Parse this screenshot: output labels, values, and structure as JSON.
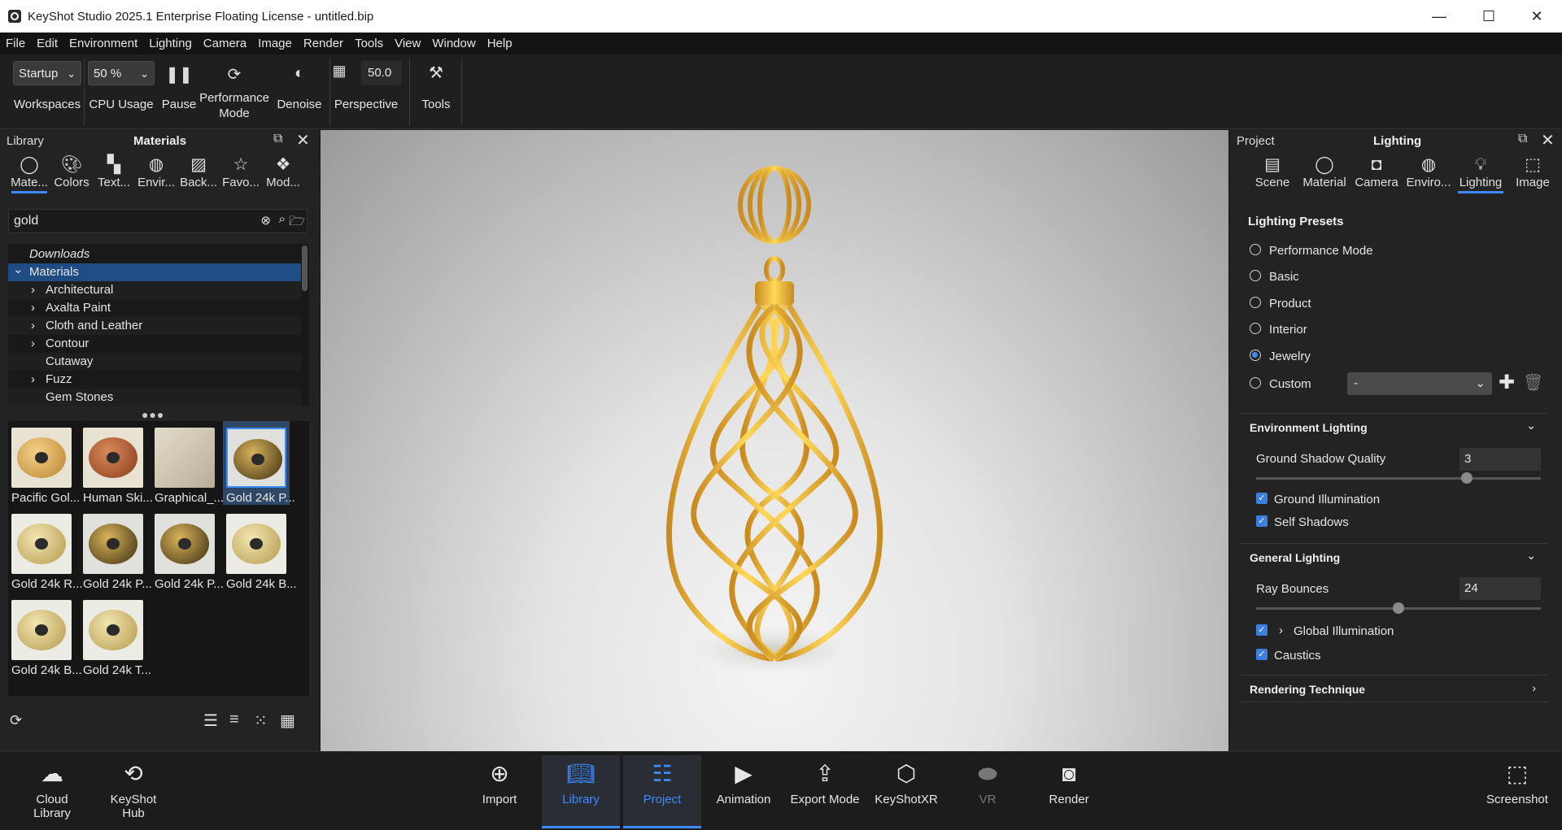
{
  "window": {
    "title": "KeyShot Studio 2025.1 Enterprise Floating License  - untitled.bip"
  },
  "menu": [
    "File",
    "Edit",
    "Environment",
    "Lighting",
    "Camera",
    "Image",
    "Render",
    "Tools",
    "View",
    "Window",
    "Help"
  ],
  "toolbar": {
    "workspace_value": "Startup",
    "workspaces_label": "Workspaces",
    "cpu_value": "50 %",
    "cpu_label": "CPU Usage",
    "pause_label": "Pause",
    "perf_label_1": "Performance",
    "perf_label_2": "Mode",
    "denoise_label": "Denoise",
    "fov_value": "50.0",
    "perspective_label": "Perspective",
    "tools_label": "Tools"
  },
  "library": {
    "left_title": "Library",
    "center_title": "Materials",
    "tabs": [
      {
        "label": "Mate...",
        "icon": "material-icon"
      },
      {
        "label": "Colors",
        "icon": "palette-icon"
      },
      {
        "label": "Text...",
        "icon": "texture-icon"
      },
      {
        "label": "Envir...",
        "icon": "globe-icon"
      },
      {
        "label": "Back...",
        "icon": "image-icon"
      },
      {
        "label": "Favo...",
        "icon": "star-icon"
      },
      {
        "label": "Mod...",
        "icon": "models-icon"
      }
    ],
    "search_value": "gold",
    "tree": [
      {
        "label": "Downloads",
        "indent": 0,
        "arrow": "",
        "italic": true,
        "selected": false
      },
      {
        "label": "Materials",
        "indent": 0,
        "arrow": "⌄",
        "italic": false,
        "selected": true
      },
      {
        "label": "Architectural",
        "indent": 1,
        "arrow": "›",
        "italic": false,
        "selected": false
      },
      {
        "label": "Axalta Paint",
        "indent": 1,
        "arrow": "›",
        "italic": false,
        "selected": false
      },
      {
        "label": "Cloth and Leather",
        "indent": 1,
        "arrow": "›",
        "italic": false,
        "selected": false
      },
      {
        "label": "Contour",
        "indent": 1,
        "arrow": "›",
        "italic": false,
        "selected": false
      },
      {
        "label": "Cutaway",
        "indent": 1,
        "arrow": "",
        "italic": false,
        "selected": false
      },
      {
        "label": "Fuzz",
        "indent": 1,
        "arrow": "›",
        "italic": false,
        "selected": false
      },
      {
        "label": "Gem Stones",
        "indent": 1,
        "arrow": "",
        "italic": false,
        "selected": false
      }
    ],
    "thumbnails": [
      {
        "label": "Pacific Gol...",
        "style": "gold-light"
      },
      {
        "label": "Human Ski...",
        "style": "skin"
      },
      {
        "label": "Graphical_...",
        "style": "cloth"
      },
      {
        "label": "Gold 24k P...",
        "style": "gold-dark",
        "selected": true
      },
      {
        "label": "Gold 24k R...",
        "style": "gold-pale"
      },
      {
        "label": "Gold 24k P...",
        "style": "gold-dark"
      },
      {
        "label": "Gold 24k P...",
        "style": "gold-dark"
      },
      {
        "label": "Gold 24k B...",
        "style": "gold-pale"
      },
      {
        "label": "Gold 24k B...",
        "style": "gold-pale"
      },
      {
        "label": "Gold 24k T...",
        "style": "gold-pale"
      }
    ]
  },
  "project": {
    "left_title": "Project",
    "center_title": "Lighting",
    "tabs": [
      {
        "label": "Scene",
        "icon": "scene-icon"
      },
      {
        "label": "Material",
        "icon": "material-icon"
      },
      {
        "label": "Camera",
        "icon": "camera-icon"
      },
      {
        "label": "Enviro...",
        "icon": "globe-icon"
      },
      {
        "label": "Lighting",
        "icon": "bulb-icon"
      },
      {
        "label": "Image",
        "icon": "image-frame-icon"
      }
    ],
    "presets_title": "Lighting Presets",
    "presets": [
      {
        "label": "Performance Mode",
        "selected": false
      },
      {
        "label": "Basic",
        "selected": false
      },
      {
        "label": "Product",
        "selected": false
      },
      {
        "label": "Interior",
        "selected": false
      },
      {
        "label": "Jewelry",
        "selected": true
      },
      {
        "label": "Custom",
        "selected": false
      }
    ],
    "custom_value": "-",
    "env_lighting": {
      "title": "Environment Lighting",
      "ground_shadow_label": "Ground Shadow Quality",
      "ground_shadow_value": "3",
      "ground_shadow_level": 0.75,
      "ground_illumination": "Ground Illumination",
      "self_shadows": "Self Shadows"
    },
    "general_lighting": {
      "title": "General Lighting",
      "ray_bounces_label": "Ray Bounces",
      "ray_bounces_value": "24",
      "ray_bounces_level": 0.5,
      "global_illumination": "Global Illumination",
      "caustics": "Caustics"
    },
    "rendering_technique": "Rendering Technique"
  },
  "bottom": {
    "cloud_library_1": "Cloud",
    "cloud_library_2": "Library",
    "keyshot_hub_1": "KeyShot",
    "keyshot_hub_2": "Hub",
    "import": "Import",
    "library": "Library",
    "project": "Project",
    "animation": "Animation",
    "export_mode": "Export Mode",
    "keyshotxr": "KeyShotXR",
    "vr": "VR",
    "render": "Render",
    "screenshot": "Screenshot"
  },
  "colors": {
    "accent": "#3d8bff",
    "gold": "#e8b63c"
  }
}
